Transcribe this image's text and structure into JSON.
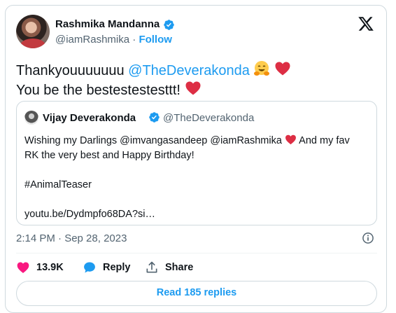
{
  "author": {
    "name": "Rashmika Mandanna",
    "handle": "@iamRashmika",
    "separator": "·",
    "follow_label": "Follow"
  },
  "tweet": {
    "line1_text": "Thankyouuuuuuu ",
    "line1_mention": "@TheDeverakonda",
    "line2_text": "You be the bestestestesttt!"
  },
  "quoted": {
    "name": "Vijay Deverakonda",
    "handle": "@TheDeverakonda",
    "line1": "Wishing my Darlings @imvangasandeep @iamRashmika",
    "line1_after": " And my fav",
    "line2": "RK the very best and Happy Birthday!",
    "line3": "#AnimalTeaser",
    "line4": "youtu.be/Dydmpfo68DA?si…"
  },
  "meta": {
    "time": "2:14 PM · Sep 28, 2023"
  },
  "actions": {
    "likes": "13.9K",
    "reply_label": "Reply",
    "share_label": "Share"
  },
  "replies_button": "Read 185 replies",
  "colors": {
    "accent": "#1d9bf0",
    "heart": "#f91880",
    "emoji_heart": "#dd2e44"
  },
  "icons": [
    "verified-badge-icon",
    "x-logo-icon",
    "hug-emoji-icon",
    "red-heart-emoji-icon",
    "info-icon",
    "heart-icon",
    "reply-bubble-icon",
    "share-icon"
  ]
}
